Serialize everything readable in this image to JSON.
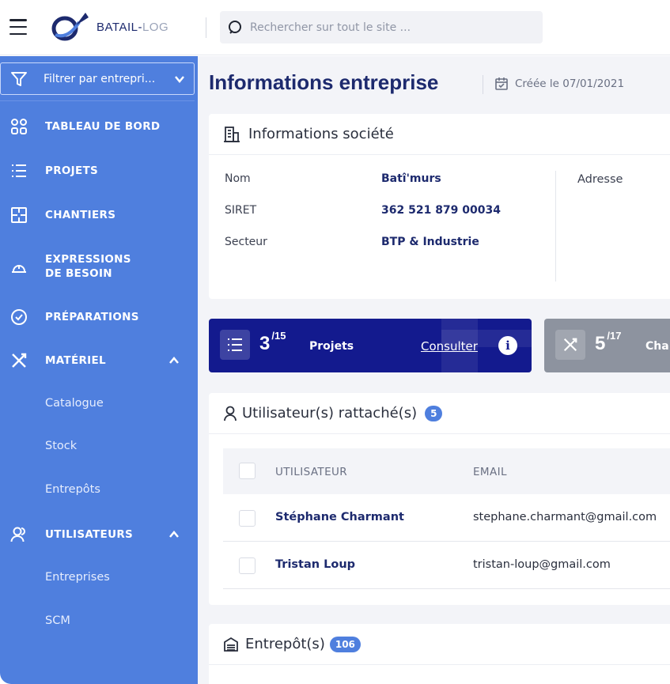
{
  "topbar": {
    "logo_text_a": "BATAIL-",
    "logo_text_b": "LOG",
    "search_placeholder": "Rechercher sur tout le site ..."
  },
  "sidebar": {
    "filter_label": "Filtrer par entrepri...",
    "items": [
      {
        "label": "TABLEAU DE BORD",
        "icon": "dashboard-icon"
      },
      {
        "label": "PROJETS",
        "icon": "list-icon"
      },
      {
        "label": "CHANTIERS",
        "icon": "floorplan-icon"
      },
      {
        "label": "EXPRESSIONS DE BESOIN",
        "line1": "EXPRESSIONS",
        "line2": "DE BESOIN",
        "icon": "hardhat-icon"
      },
      {
        "label": "PRÉPARATIONS",
        "icon": "check-circle-icon"
      },
      {
        "label": "MATÉRIEL",
        "icon": "tools-icon",
        "expanded": true
      },
      {
        "label": "UTILISATEURS",
        "icon": "users-icon",
        "expanded": true
      }
    ],
    "materiel_sub": [
      "Catalogue",
      "Stock",
      "Entrepôts"
    ],
    "utilisateurs_sub": [
      "Entreprises",
      "SCM"
    ]
  },
  "main": {
    "title": "Informations entreprise",
    "created": "Créée le 07/01/2021",
    "company_card": {
      "title": "Informations société",
      "fields": [
        {
          "label": "Nom",
          "value": "Batî'murs"
        },
        {
          "label": "SIRET",
          "value": "362 521 879 00034"
        },
        {
          "label": "Secteur",
          "value": "BTP & Industrie"
        }
      ],
      "address_label": "Adresse"
    },
    "stats": [
      {
        "value": "3",
        "total": "/15",
        "label": "Projets",
        "link": "Consulter",
        "info": "i"
      },
      {
        "value": "5",
        "total": "/17",
        "label": "Cha"
      }
    ],
    "users_card": {
      "title": "Utilisateur(s) rattaché(s)",
      "count": "5",
      "columns": [
        "UTILISATEUR",
        "EMAIL"
      ],
      "rows": [
        {
          "name": "Stéphane Charmant",
          "email": "stephane.charmant@gmail.com"
        },
        {
          "name": "Tristan Loup",
          "email": "tristan-loup@gmail.com"
        }
      ]
    },
    "warehouse_card": {
      "title": "Entrepôt(s)",
      "count": "106"
    }
  },
  "colors": {
    "sidebar": "#4f7fde",
    "navy": "#1d2a6e",
    "stat_primary": "#131a8e",
    "stat_secondary": "#8d939f"
  }
}
